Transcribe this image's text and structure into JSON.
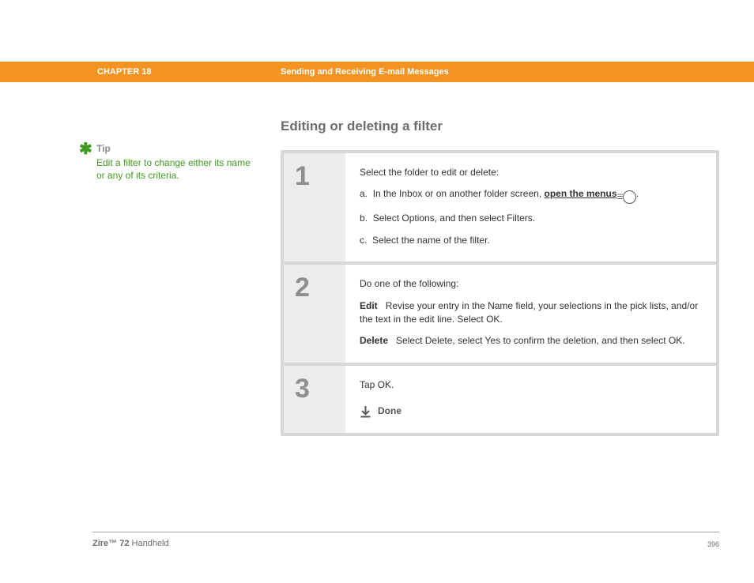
{
  "header": {
    "chapter": "CHAPTER 18",
    "title": "Sending and Receiving E-mail Messages"
  },
  "tip": {
    "asterisk": "✱",
    "label": "Tip",
    "text": "Edit a filter to change either its name or any of its criteria."
  },
  "section_title": "Editing or deleting a filter",
  "steps": [
    {
      "num": "1",
      "lead": "Select the folder to edit or delete:",
      "substeps": [
        {
          "prefix": "a.",
          "before_link": "In the Inbox or on another folder screen, ",
          "link": "open the menus",
          "after_link": "."
        },
        {
          "prefix": "b.",
          "text": "Select Options, and then select Filters."
        },
        {
          "prefix": "c.",
          "text": "Select the name of the filter."
        }
      ]
    },
    {
      "num": "2",
      "lead": "Do one of the following:",
      "defs": [
        {
          "term": "Edit",
          "desc": "Revise your entry in the Name field, your selections in the pick lists, and/or the text in the edit line. Select OK."
        },
        {
          "term": "Delete",
          "desc": "Select Delete, select Yes to confirm the deletion, and then select OK."
        }
      ]
    },
    {
      "num": "3",
      "lead": "Tap OK.",
      "done_label": "Done"
    }
  ],
  "footer": {
    "product_bold": "Zire™ 72",
    "product_rest": " Handheld",
    "page_number": "396"
  }
}
